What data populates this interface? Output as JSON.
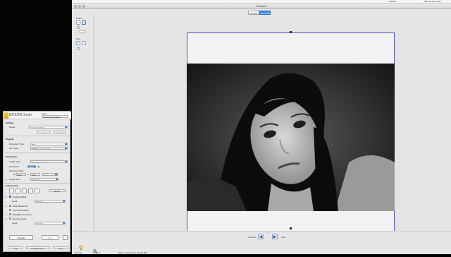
{
  "menubar": {
    "time_text": "Mon 11 Apr 10:12",
    "battery": "1:11:08"
  },
  "preview": {
    "window_title": "Preview",
    "tabs": [
      {
        "label": "Normal",
        "active": false
      },
      {
        "label": "Thumbnail",
        "active": true
      }
    ],
    "tool_labels": {
      "frame": "Frame",
      "size": "Size"
    },
    "nav": {
      "previous": "Previous",
      "next": "Next",
      "frame_number": "1"
    },
    "status": {
      "x": "52.7mm",
      "y": "37.6mm",
      "pixels": "9906 x 7168 pixels 136.29 MB"
    }
  },
  "epson": {
    "brand": "EPSON Scan",
    "mode_label": "Mode:",
    "mode_value": "Professional Mode",
    "settings": {
      "section": "Settings",
      "name_label": "Name:",
      "name_value": "Current Setting",
      "save": "Save",
      "delete": "Delete"
    },
    "original": {
      "section": "Original",
      "doc_type_label": "Document Type:",
      "doc_type_value": "Film",
      "film_type_label": "Film Type:",
      "film_type_value": "B&W Negative Film"
    },
    "destination": {
      "section": "Destination",
      "image_type_label": "Image Type:",
      "image_type_value": "16-bit Grayscale",
      "resolution_label": "Resolution:",
      "resolution_value": "4800",
      "dpi": "dpi",
      "doc_size_label": "Document Size:",
      "w_label": "W",
      "w_value": "52.7",
      "h_value": "37.6",
      "unit": "mm",
      "target_size_label": "Target Size:",
      "target_size_value": "Original"
    },
    "adjustments": {
      "section": "Adjustments",
      "reset": "Reset",
      "unsharp": "Unsharp Mask",
      "level_label": "Level:",
      "unsharp_level": "Medium",
      "grain": "Grain Reduction",
      "color_restore": "Color Restoration",
      "backlight": "Backlight Correction",
      "dust": "Dust Removal",
      "dust_level": "Medium"
    },
    "buttons": {
      "preview": "Preview",
      "scan": "Scan",
      "help": "Help",
      "configuration": "Configuration...",
      "close": "Close"
    }
  }
}
